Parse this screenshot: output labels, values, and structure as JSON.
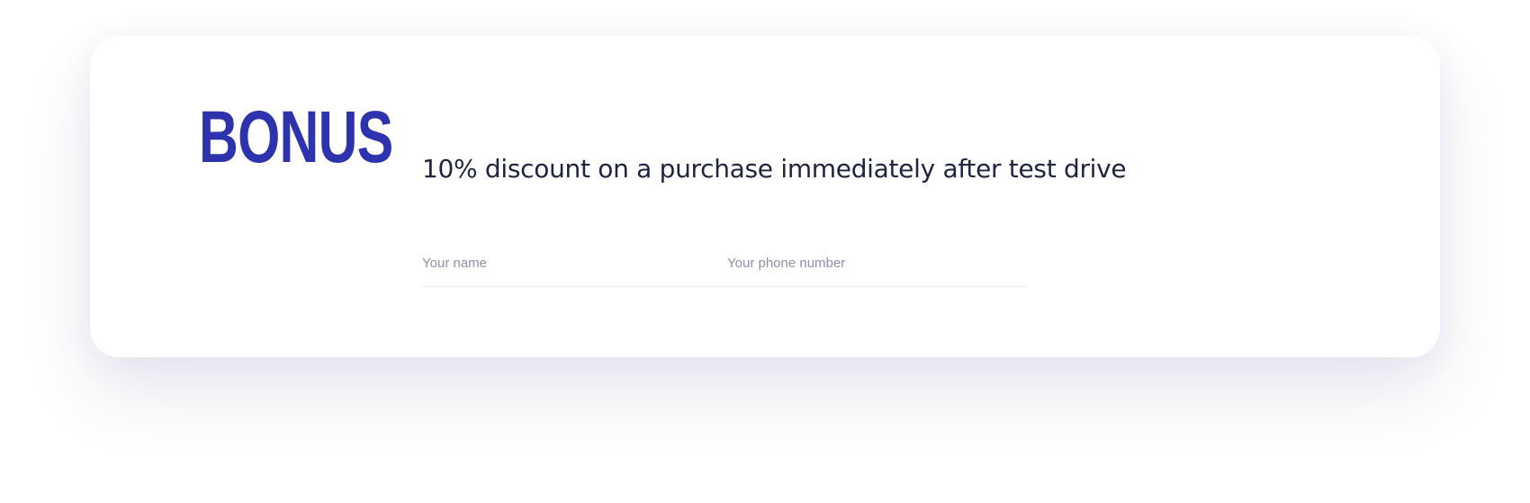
{
  "card": {
    "title": "BONUS",
    "offer": "10% discount on a purchase immediately after test drive"
  },
  "form": {
    "name_placeholder": "Your name",
    "name_value": "",
    "phone_placeholder": "Your phone number",
    "phone_value": ""
  },
  "colors": {
    "accent": "#2d32ad",
    "heading_text": "#1f2440",
    "placeholder_text": "#8d90a8",
    "divider": "#e6e7ee"
  }
}
